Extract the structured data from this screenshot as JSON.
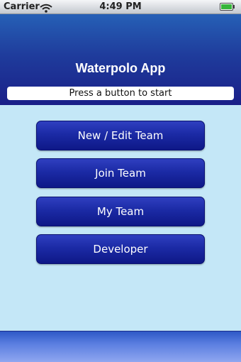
{
  "status_bar": {
    "carrier": "Carrier",
    "time": "4:49 PM",
    "wifi_icon": "wifi-icon",
    "battery_icon": "battery-icon"
  },
  "header": {
    "title": "Waterpolo App",
    "status_message": "Press a button to start"
  },
  "menu": {
    "buttons": [
      {
        "label": "New / Edit Team"
      },
      {
        "label": "Join Team"
      },
      {
        "label": "My Team"
      },
      {
        "label": "Developer"
      }
    ]
  },
  "colors": {
    "background": "#c4e7f7",
    "header_blue": "#1f3c9c",
    "button_blue": "#1b2aa5",
    "button_text": "#ffffff"
  }
}
